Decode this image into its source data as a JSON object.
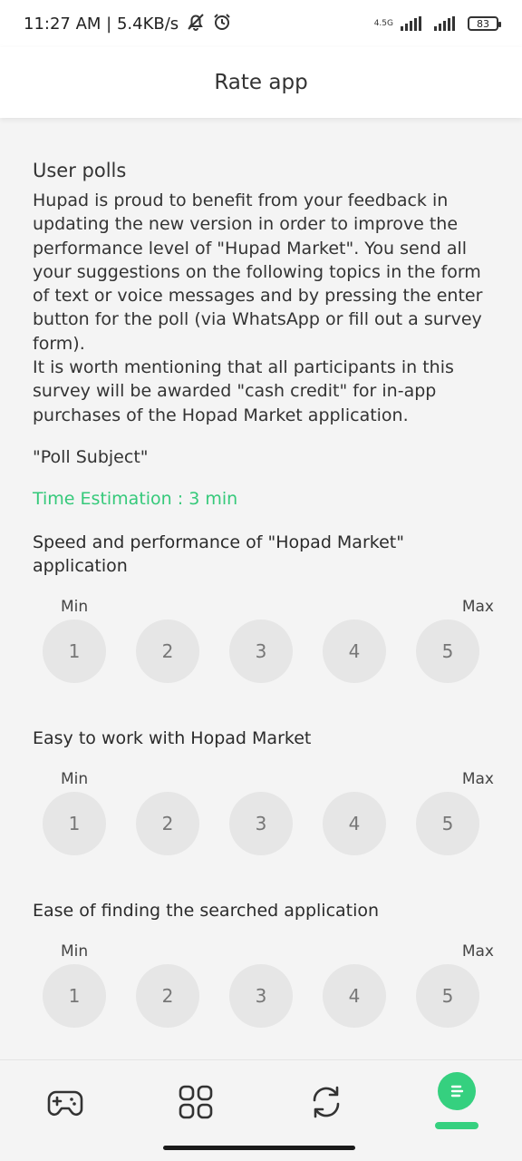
{
  "status_bar": {
    "time_speed": "11:27 AM | 5.4KB/s",
    "network_label": "4.5G",
    "battery": "83"
  },
  "header": {
    "title": "Rate app"
  },
  "main": {
    "section_title": "User polls",
    "intro_p1": "Hupad is proud to benefit from your feedback in updating the new version in order to improve the performance level of \"Hupad Market\". You send all your suggestions on the following topics in the form of text or voice messages and by pressing the enter button for the poll (via WhatsApp or fill out a survey form).",
    "intro_p2": "It is worth mentioning that all participants in this survey will be awarded \"cash credit\" for in-app purchases of the Hopad Market application.",
    "poll_subject": "\"Poll Subject\"",
    "time_estimation": "Time Estimation : 3 min",
    "scale_min": "Min",
    "scale_max": "Max",
    "questions": [
      {
        "text": "Speed and performance of \"Hopad Market\" application",
        "options": [
          "1",
          "2",
          "3",
          "4",
          "5"
        ]
      },
      {
        "text": "Easy to work with Hopad Market",
        "options": [
          "1",
          "2",
          "3",
          "4",
          "5"
        ]
      },
      {
        "text": "Ease of finding the searched application",
        "options": [
          "1",
          "2",
          "3",
          "4",
          "5"
        ]
      }
    ]
  },
  "bottom_nav": {
    "items": [
      {
        "icon": "gamepad-icon"
      },
      {
        "icon": "apps-grid-icon"
      },
      {
        "icon": "refresh-icon"
      },
      {
        "icon": "chat-bubble-icon",
        "active": true
      }
    ]
  },
  "colors": {
    "accent": "#35d07f",
    "time_text": "#35c97a",
    "circle_bg": "#e6e6e6",
    "background": "#f4f4f4"
  }
}
